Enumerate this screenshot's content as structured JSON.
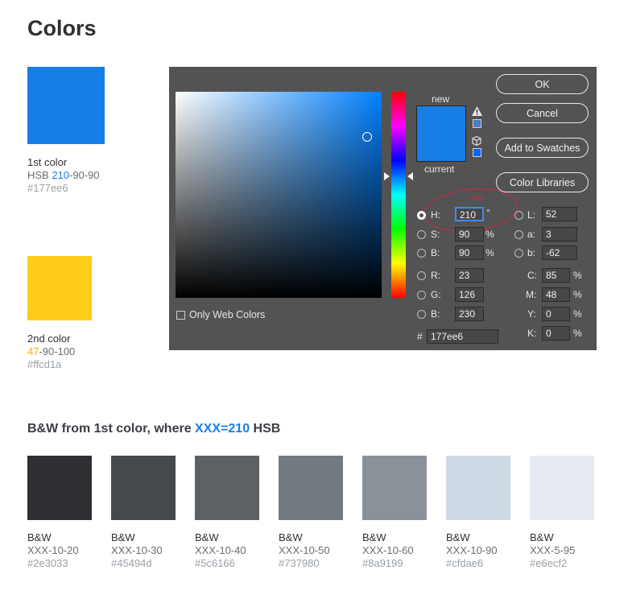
{
  "title": "Colors",
  "colors": [
    {
      "label": "1st color",
      "prefix": "HSB ",
      "hue": "210",
      "rest": "-90-90",
      "hex": "#177ee6",
      "swatch": "#177ee6"
    },
    {
      "label": "2nd color",
      "prefix": "",
      "hue": "47",
      "rest": "-90-100",
      "hex": "#ffcd1a",
      "swatch": "#ffcd1a"
    }
  ],
  "dialog": {
    "new_label": "new",
    "current_label": "current",
    "new_color": "#177ee6",
    "current_color": "#177ee6",
    "buttons": {
      "ok": "OK",
      "cancel": "Cancel",
      "add_swatches": "Add to Swatches",
      "libraries": "Color Libraries"
    },
    "web_colors_label": "Only Web Colors",
    "annotation": "XXX",
    "hsb": {
      "h": "210",
      "s": "90",
      "b": "90"
    },
    "rgb": {
      "r": "23",
      "g": "126",
      "b": "230"
    },
    "lab": {
      "l": "52",
      "a": "3",
      "b": "-62"
    },
    "cmyk": {
      "c": "85",
      "m": "48",
      "y": "0",
      "k": "0"
    },
    "hex": "177ee6",
    "labels": {
      "h": "H:",
      "s": "S:",
      "b": "B:",
      "r": "R:",
      "g": "G:",
      "bb": "B:",
      "l": "L:",
      "a": "a:",
      "lb": "b:",
      "c": "C:",
      "m": "M:",
      "y": "Y:",
      "k": "K:",
      "hash": "#"
    },
    "units": {
      "deg": "°",
      "pct": "%"
    }
  },
  "bw_section": {
    "title_prefix": "B&W from 1st color, where ",
    "title_highlight": "XXX=210",
    "title_suffix": " HSB",
    "swatches": [
      {
        "label": "B&W",
        "code": "XXX-10-20",
        "hex": "#2e3033"
      },
      {
        "label": "B&W",
        "code": "XXX-10-30",
        "hex": "#45494d"
      },
      {
        "label": "B&W",
        "code": "XXX-10-40",
        "hex": "#5c6166"
      },
      {
        "label": "B&W",
        "code": "XXX-10-50",
        "hex": "#737980"
      },
      {
        "label": "B&W",
        "code": "XXX-10-60",
        "hex": "#8a9199"
      },
      {
        "label": "B&W",
        "code": "XXX-10-90",
        "hex": "#cfdae6"
      },
      {
        "label": "B&W",
        "code": "XXX-5-95",
        "hex": "#e6ecf2"
      }
    ]
  }
}
